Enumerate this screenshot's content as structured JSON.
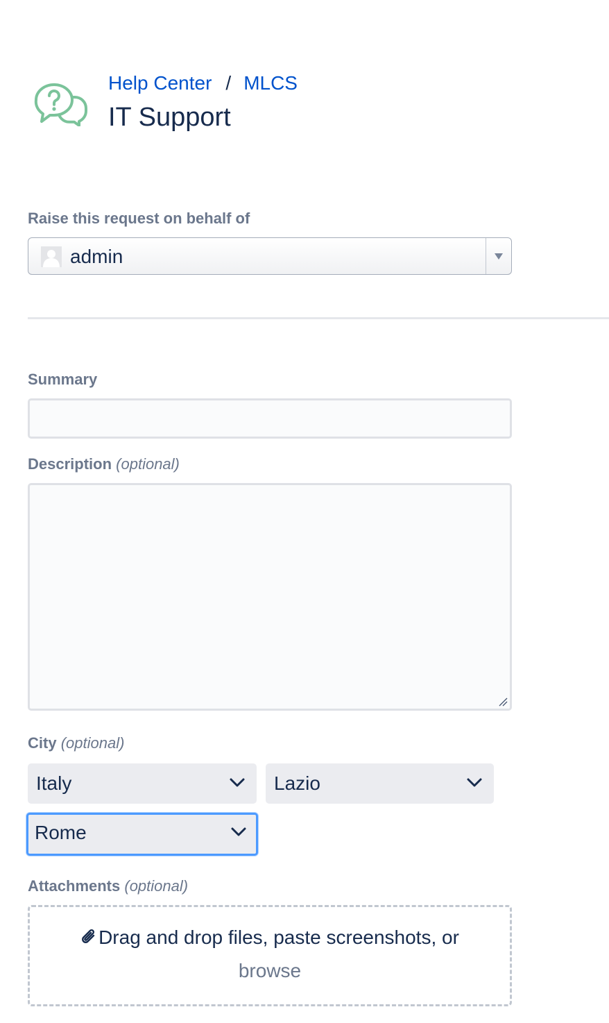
{
  "header": {
    "breadcrumb": {
      "help_center": "Help Center",
      "separator": "/",
      "project": "MLCS"
    },
    "title": "IT Support",
    "logo_icon": "question-chat-bubbles-icon",
    "logo_color": "#7bc39a"
  },
  "form": {
    "on_behalf": {
      "label": "Raise this request on behalf of",
      "value": "admin",
      "avatar_icon": "default-user-avatar-icon"
    },
    "summary": {
      "label": "Summary",
      "value": ""
    },
    "description": {
      "label": "Description",
      "optional": "(optional)",
      "value": ""
    },
    "city": {
      "label": "City",
      "optional": "(optional)",
      "country": "Italy",
      "region": "Lazio",
      "city": "Rome"
    },
    "attachments": {
      "label": "Attachments",
      "optional": "(optional)",
      "drop_text": "Drag and drop files, paste screenshots, or",
      "browse_link": "browse",
      "icon": "paperclip-icon"
    }
  },
  "colors": {
    "link": "#0052cc",
    "text": "#172b4d",
    "label": "#6b778c",
    "focus": "#4c9aff"
  }
}
